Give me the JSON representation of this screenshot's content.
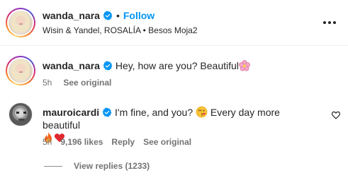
{
  "post_header": {
    "username": "wanda_nara",
    "dot": "•",
    "follow_label": "Follow",
    "audio_subtitle": "Wisin & Yandel, ROSALÍA • Besos Moja2"
  },
  "comments": [
    {
      "username": "wanda_nara",
      "text": "Hey, how are you? Beautiful",
      "time": "5h",
      "see_original": "See original"
    },
    {
      "username": "mauroicardi",
      "text_part1": "I'm fine, and you?",
      "text_part2": "Every day more beautiful",
      "time": "5h",
      "likes": "9,196 likes",
      "reply": "Reply",
      "see_original": "See original",
      "view_replies": "View replies (1233)"
    }
  ],
  "colors": {
    "accent": "#0095f6",
    "text": "#262626",
    "secondary": "#737373",
    "verified": "#0095f6"
  },
  "icons": [
    "verified-badge-icon",
    "more-options-icon",
    "flower-emoji-icon",
    "kiss-face-emoji-icon",
    "fire-emoji-icon",
    "red-heart-emoji-icon",
    "heart-outline-icon"
  ]
}
